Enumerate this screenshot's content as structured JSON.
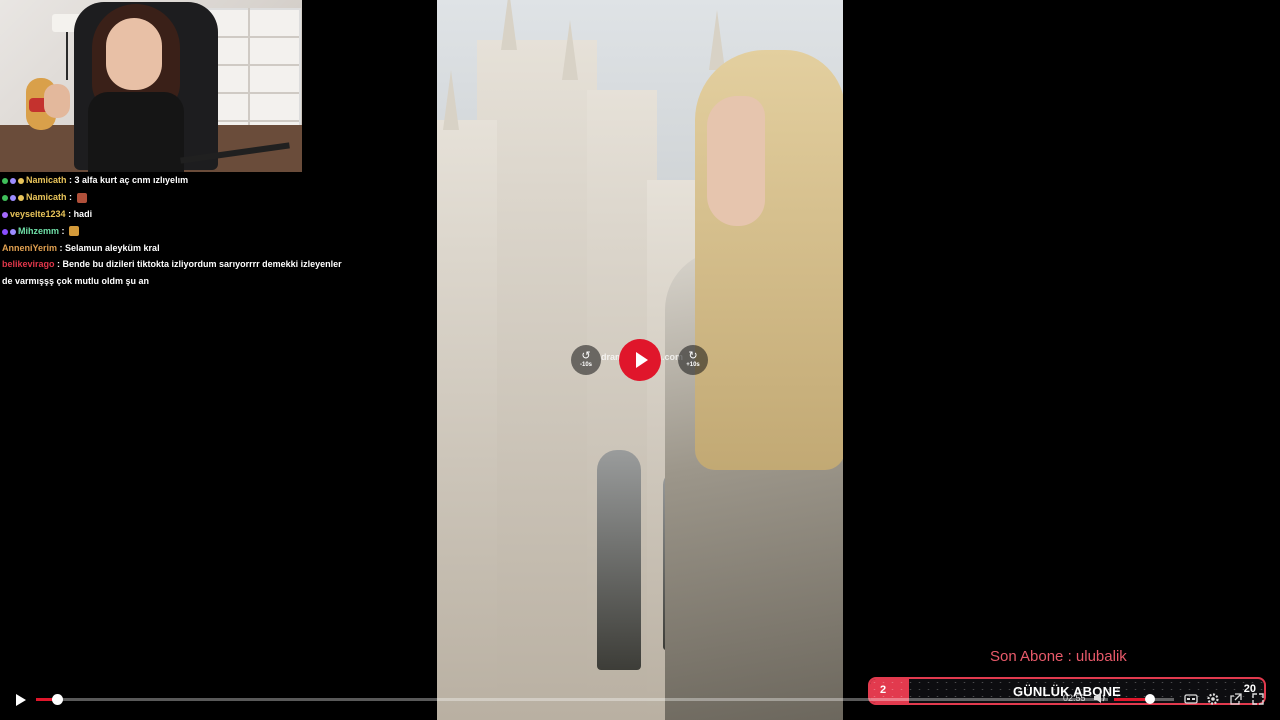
{
  "chat": {
    "lines": [
      {
        "user": "Namicath",
        "user_color": "#e8c45a",
        "message": "3 alfa kurt aç cnm ızlıyelım",
        "badges": [
          "#3fbf5a",
          "#9c8cff",
          "#e8c45a"
        ],
        "emote": ""
      },
      {
        "user": "Namicath",
        "user_color": "#e8c45a",
        "message": "",
        "badges": [
          "#3fbf5a",
          "#9c8cff",
          "#e8c45a"
        ],
        "emote": "#b0503a"
      },
      {
        "user": "veyselte1234",
        "user_color": "#e8c45a",
        "message": "hadi",
        "badges": [
          "#a56aff"
        ],
        "emote": ""
      },
      {
        "user": "Mihzemm",
        "user_color": "#6fe0a8",
        "message": "",
        "badges": [
          "#8a4dff",
          "#9c8cff"
        ],
        "emote": "#d49a3a"
      },
      {
        "user": "AnneniYerim",
        "user_color": "#e0a050",
        "message": "Selamun aleyküm kral",
        "badges": [],
        "emote": ""
      },
      {
        "user": "belikevirago",
        "user_color": "#e0364a",
        "message": "Bende bu dizileri tiktokta izliyordum sarıyorrrr demekki izleyenler de varmışşş çok mutlu oldm şu an",
        "badges": [],
        "emote": ""
      }
    ]
  },
  "video": {
    "watermark": "dramadizierim.com",
    "rewind_label": "-10s",
    "forward_label": "+10s"
  },
  "sub_alert": {
    "last_sub": "Son Abone : ulubalik",
    "goal_title": "GÜNLÜK ABONE",
    "goal_current": "2",
    "goal_target": "20",
    "goal_fraction": 0.1,
    "accent": "#e23a4e"
  },
  "player": {
    "progress_fraction": 0.02,
    "time": "02:55",
    "volume_fraction": 0.6,
    "accent": "#e0162b",
    "icons": [
      "play-icon",
      "volume-icon",
      "captions-icon",
      "settings-icon",
      "picture-in-picture-icon",
      "fullscreen-icon"
    ]
  }
}
